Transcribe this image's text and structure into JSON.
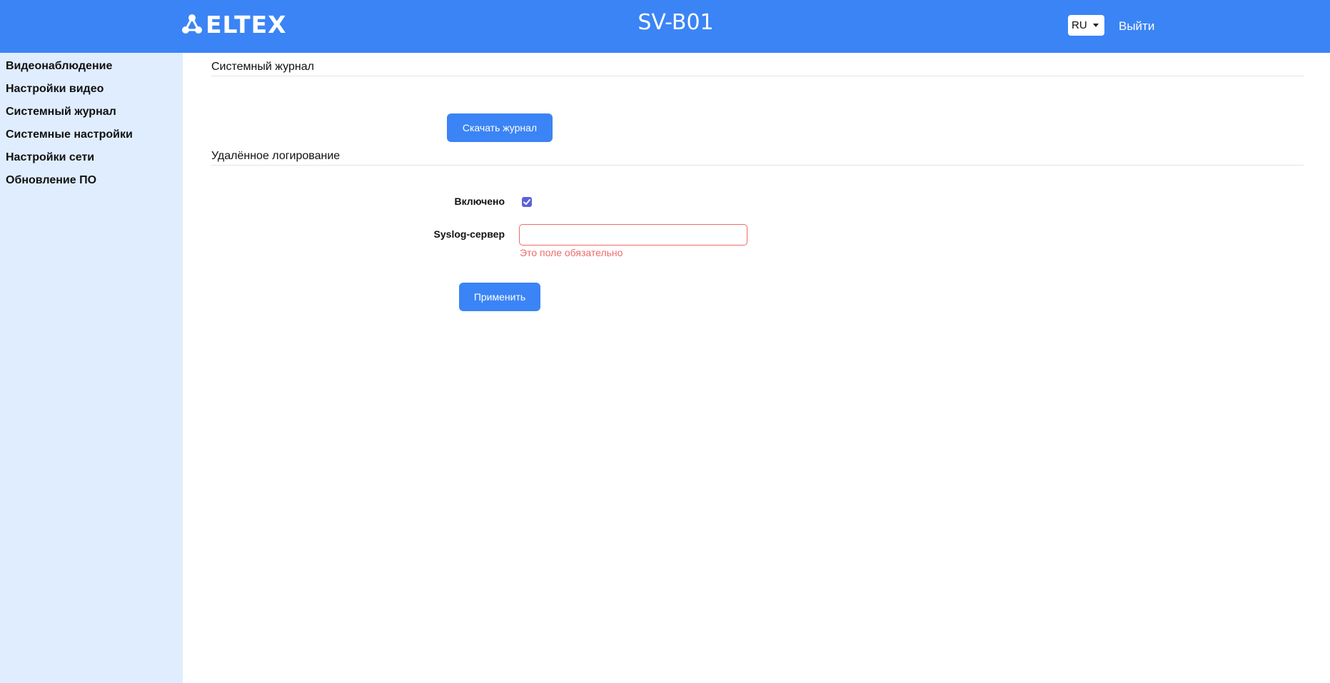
{
  "header": {
    "brand": "ELTEX",
    "device_name": "SV-B01",
    "language": "RU",
    "logout_label": "Выйти"
  },
  "sidebar": {
    "items": [
      {
        "label": "Видеонаблюдение"
      },
      {
        "label": "Настройки видео"
      },
      {
        "label": "Системный журнал"
      },
      {
        "label": "Системные настройки"
      },
      {
        "label": "Настройки сети"
      },
      {
        "label": "Обновление ПО"
      }
    ]
  },
  "main": {
    "syslog_section": {
      "title": "Системный журнал",
      "download_label": "Скачать журнал"
    },
    "remote_section": {
      "title": "Удалённое логирование",
      "enabled_label": "Включено",
      "enabled": true,
      "server_label": "Syslog-сервер",
      "server_value": "",
      "server_error": "Это поле обязательно",
      "apply_label": "Применить"
    }
  },
  "colors": {
    "header_bg": "#3b84f5",
    "sidebar_bg": "#e0edfe",
    "button_bg": "#3b84f5",
    "error": "#f06a6a",
    "checkbox": "#5b62d8"
  },
  "icons": {
    "logo": "eltex-logo-icon",
    "lang_caret": "caret-down-icon",
    "checkbox_check": "check-icon"
  }
}
